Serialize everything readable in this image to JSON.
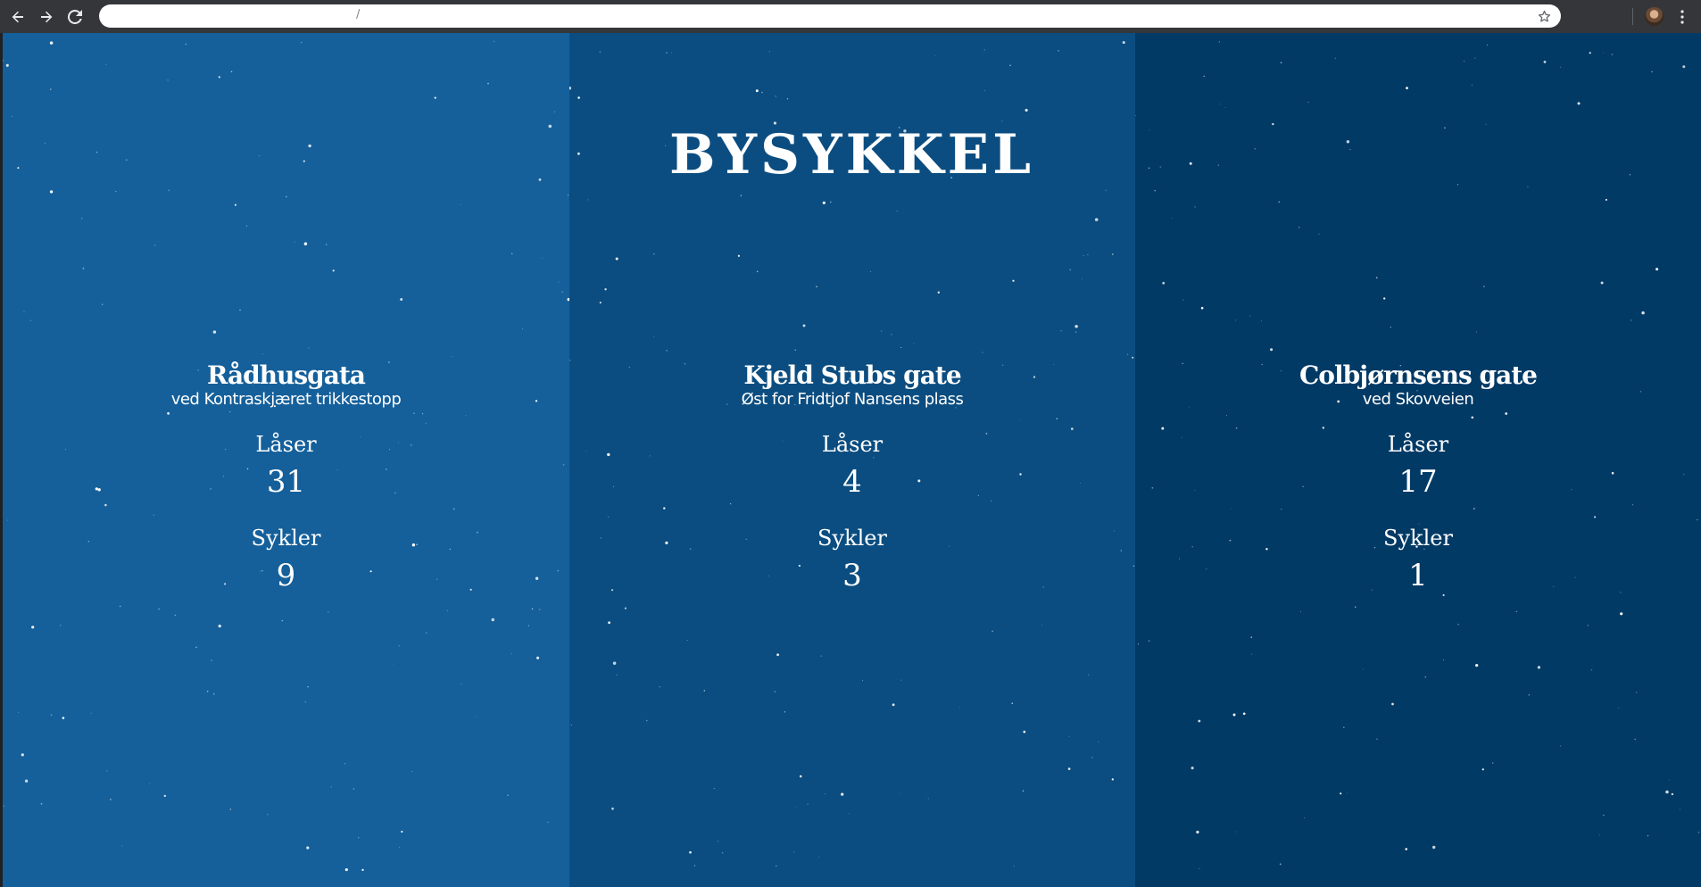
{
  "browser": {
    "address": "/",
    "icons": {
      "back": "arrow-left-icon",
      "forward": "arrow-right-icon",
      "reload": "reload-icon",
      "bookmark": "star-icon",
      "menu": "kebab-menu-icon"
    }
  },
  "page": {
    "title": "BYSYKKEL",
    "colors": [
      "#15609b",
      "#0b4d80",
      "#023a66"
    ],
    "stations": [
      {
        "name": "Rådhusgata",
        "description": "ved Kontraskjæret trikkestopp",
        "locks_label": "Låser",
        "locks": "31",
        "bikes_label": "Sykler",
        "bikes": "9"
      },
      {
        "name": "Kjeld Stubs gate",
        "description": "Øst for Fridtjof Nansens plass",
        "locks_label": "Låser",
        "locks": "4",
        "bikes_label": "Sykler",
        "bikes": "3"
      },
      {
        "name": "Colbjørnsens gate",
        "description": "ved Skovveien",
        "locks_label": "Låser",
        "locks": "17",
        "bikes_label": "Sykler",
        "bikes": "1"
      }
    ]
  }
}
